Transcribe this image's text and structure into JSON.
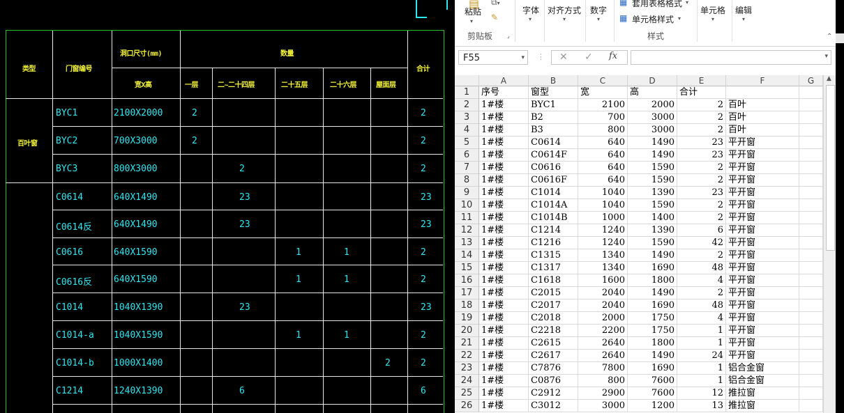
{
  "cad": {
    "headers": {
      "type": "类型",
      "code": "门窗编号",
      "size": "洞口尺寸(mm)",
      "qty": "数量",
      "total": "合计",
      "wh": "宽X高",
      "f1": "一层",
      "f2": "二~二十四层",
      "f25": "二十五层",
      "f26": "二十六层",
      "roof": "屋面层"
    },
    "group1_label": "百叶窗",
    "rows": [
      {
        "code": "BYC1",
        "size": "2100X2000",
        "f1": "2",
        "f2": "",
        "f25": "",
        "f26": "",
        "roof": "",
        "total": "2"
      },
      {
        "code": "BYC2",
        "size": "700X3000",
        "f1": "2",
        "f2": "",
        "f25": "",
        "f26": "",
        "roof": "",
        "total": "2"
      },
      {
        "code": "BYC3",
        "size": "800X3000",
        "f1": "",
        "f2": "2",
        "f25": "",
        "f26": "",
        "roof": "",
        "total": "2"
      },
      {
        "code": "C0614",
        "size": "640X1490",
        "f1": "",
        "f2": "23",
        "f25": "",
        "f26": "",
        "roof": "",
        "total": "23"
      },
      {
        "code": "C0614反",
        "size": "640X1490",
        "f1": "",
        "f2": "23",
        "f25": "",
        "f26": "",
        "roof": "",
        "total": "23"
      },
      {
        "code": "C0616",
        "size": "640X1590",
        "f1": "",
        "f2": "",
        "f25": "1",
        "f26": "1",
        "roof": "",
        "total": "2"
      },
      {
        "code": "C0616反",
        "size": "640X1590",
        "f1": "",
        "f2": "",
        "f25": "1",
        "f26": "1",
        "roof": "",
        "total": "2"
      },
      {
        "code": "C1014",
        "size": "1040X1390",
        "f1": "",
        "f2": "23",
        "f25": "",
        "f26": "",
        "roof": "",
        "total": "23"
      },
      {
        "code": "C1014-a",
        "size": "1040X1590",
        "f1": "",
        "f2": "",
        "f25": "1",
        "f26": "1",
        "roof": "",
        "total": "2"
      },
      {
        "code": "C1014-b",
        "size": "1000X1400",
        "f1": "",
        "f2": "",
        "f25": "",
        "f26": "",
        "roof": "2",
        "total": "2"
      },
      {
        "code": "C1214",
        "size": "1240X1390",
        "f1": "",
        "f2": "6",
        "f25": "",
        "f26": "",
        "roof": "",
        "total": "6"
      }
    ]
  },
  "excel": {
    "ribbon": {
      "paste": "粘贴",
      "font": "字体",
      "align": "对齐方式",
      "number": "数字",
      "table_format": "套用表格格式",
      "cell_style": "单元格样式",
      "cells": "单元格",
      "edit": "编辑",
      "clipboard_group": "剪贴板",
      "styles_group": "样式"
    },
    "name_box": "F55",
    "formula_value": "",
    "columns": [
      "A",
      "B",
      "C",
      "D",
      "E",
      "F",
      "G"
    ],
    "rows": [
      [
        "序号",
        "窗型",
        "宽",
        "高",
        "合计",
        ""
      ],
      [
        "1#楼",
        "BYC1",
        "2100",
        "2000",
        "2",
        "百叶"
      ],
      [
        "1#楼",
        "B2",
        "700",
        "3000",
        "2",
        "百叶"
      ],
      [
        "1#楼",
        "B3",
        "800",
        "3000",
        "2",
        "百叶"
      ],
      [
        "1#楼",
        "C0614",
        "640",
        "1490",
        "23",
        "平开窗"
      ],
      [
        "1#楼",
        "C0614F",
        "640",
        "1490",
        "23",
        "平开窗"
      ],
      [
        "1#楼",
        "C0616",
        "640",
        "1590",
        "2",
        "平开窗"
      ],
      [
        "1#楼",
        "C0616F",
        "640",
        "1590",
        "2",
        "平开窗"
      ],
      [
        "1#楼",
        "C1014",
        "1040",
        "1390",
        "23",
        "平开窗"
      ],
      [
        "1#楼",
        "C1014A",
        "1040",
        "1590",
        "2",
        "平开窗"
      ],
      [
        "1#楼",
        "C1014B",
        "1000",
        "1400",
        "2",
        "平开窗"
      ],
      [
        "1#楼",
        "C1214",
        "1240",
        "1390",
        "6",
        "平开窗"
      ],
      [
        "1#楼",
        "C1216",
        "1240",
        "1590",
        "42",
        "平开窗"
      ],
      [
        "1#楼",
        "C1315",
        "1340",
        "1490",
        "2",
        "平开窗"
      ],
      [
        "1#楼",
        "C1317",
        "1340",
        "1690",
        "48",
        "平开窗"
      ],
      [
        "1#楼",
        "C1618",
        "1600",
        "1800",
        "4",
        "平开窗"
      ],
      [
        "1#楼",
        "C2015",
        "2040",
        "1490",
        "2",
        "平开窗"
      ],
      [
        "1#楼",
        "C2017",
        "2040",
        "1690",
        "48",
        "平开窗"
      ],
      [
        "1#楼",
        "C2018",
        "2000",
        "1750",
        "4",
        "平开窗"
      ],
      [
        "1#楼",
        "C2218",
        "2200",
        "1750",
        "1",
        "平开窗"
      ],
      [
        "1#楼",
        "C2615",
        "2640",
        "1800",
        "1",
        "平开窗"
      ],
      [
        "1#楼",
        "C2617",
        "2640",
        "1490",
        "24",
        "平开窗"
      ],
      [
        "1#楼",
        "C7876",
        "7800",
        "1690",
        "1",
        "铝合金窗"
      ],
      [
        "1#楼",
        "C0876",
        "800",
        "7600",
        "1",
        "铝合金窗"
      ],
      [
        "1#楼",
        "C2912",
        "2900",
        "7600",
        "12",
        "推拉窗"
      ],
      [
        "1#楼",
        "C3012",
        "3000",
        "1200",
        "13",
        "推拉窗"
      ]
    ]
  }
}
